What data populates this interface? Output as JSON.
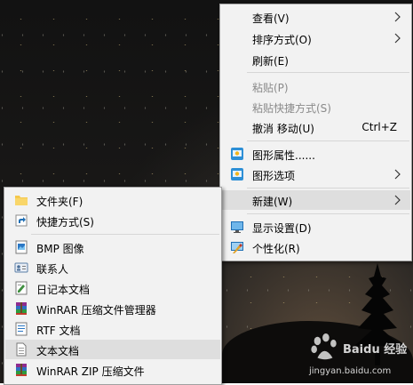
{
  "context_menu": {
    "items": [
      {
        "label": "查看(V)"
      },
      {
        "label": "排序方式(O)"
      },
      {
        "label": "刷新(E)"
      },
      {
        "label": "粘贴(P)"
      },
      {
        "label": "粘贴快捷方式(S)"
      },
      {
        "label": "撤消 移动(U)",
        "shortcut": "Ctrl+Z"
      },
      {
        "label": "图形属性......"
      },
      {
        "label": "图形选项"
      },
      {
        "label": "新建(W)"
      },
      {
        "label": "显示设置(D)"
      },
      {
        "label": "个性化(R)"
      }
    ]
  },
  "new_submenu": {
    "items": [
      {
        "label": "文件夹(F)"
      },
      {
        "label": "快捷方式(S)"
      },
      {
        "label": "BMP 图像"
      },
      {
        "label": "联系人"
      },
      {
        "label": "日记本文档"
      },
      {
        "label": "WinRAR 压缩文件管理器"
      },
      {
        "label": "RTF 文档"
      },
      {
        "label": "文本文档"
      },
      {
        "label": "WinRAR ZIP 压缩文件"
      }
    ]
  },
  "watermark": {
    "text": "jingyan.baidu.com",
    "brand": "Baidu 经验"
  },
  "colors": {
    "menu_bg": "#f2f2f2",
    "highlight": "#dedede",
    "disabled_text": "#8a8a8a"
  }
}
